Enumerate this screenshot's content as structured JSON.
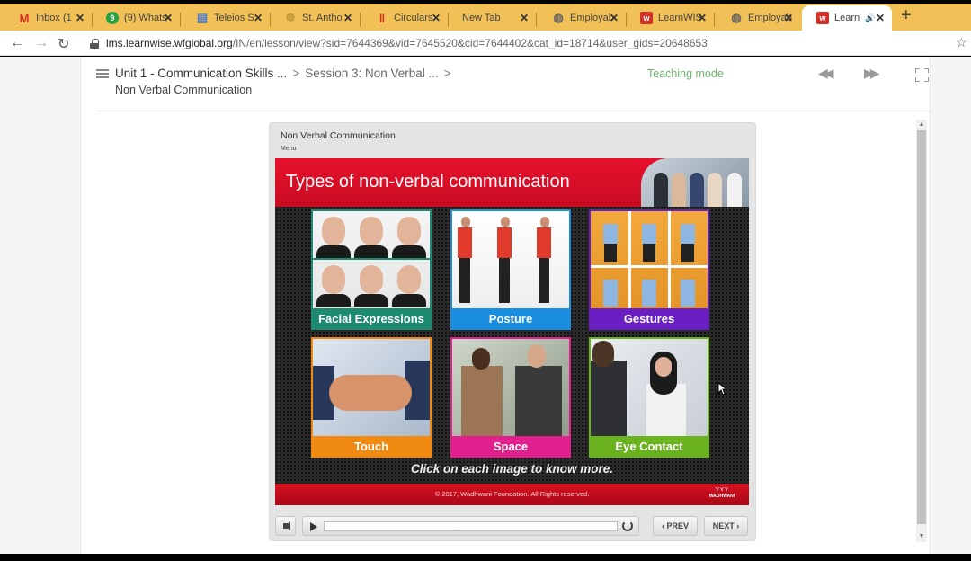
{
  "browser": {
    "tabs": [
      {
        "label": "Inbox (1",
        "icon": "gmail-icon",
        "icon_char": "M",
        "icon_color": "#d93025"
      },
      {
        "label": "(9) Whats",
        "icon": "whatsapp-icon",
        "icon_char": "9",
        "icon_color": "#25a244"
      },
      {
        "label": "Teleios S",
        "icon": "document-icon",
        "icon_char": "▤",
        "icon_color": "#4a7bd0"
      },
      {
        "label": "St. Antho",
        "icon": "school-crest-icon",
        "icon_char": "☸",
        "icon_color": "#c49a3a"
      },
      {
        "label": "Circulars",
        "icon": "circulars-icon",
        "icon_char": "‖",
        "icon_color": "#d62d20"
      },
      {
        "label": "New Tab",
        "icon": "",
        "icon_char": "",
        "icon_color": ""
      },
      {
        "label": "Employab",
        "icon": "globe-icon",
        "icon_char": "◍",
        "icon_color": "#666"
      },
      {
        "label": "LearnWIS",
        "icon": "learnwise-icon",
        "icon_char": "w",
        "icon_color": "#d0322a"
      },
      {
        "label": "Employab",
        "icon": "globe-icon",
        "icon_char": "◍",
        "icon_color": "#666"
      },
      {
        "label": "Learn",
        "icon": "learnwise-icon",
        "icon_char": "w",
        "icon_color": "#d0322a",
        "active": true,
        "audio": "🔊"
      }
    ],
    "close_glyph": "✕",
    "new_tab_glyph": "+",
    "back_glyph": "←",
    "forward_glyph": "→",
    "reload_glyph": "↻",
    "url_domain": "lms.learnwise.wfglobal.org",
    "url_path": "/IN/en/lesson/view?sid=7644369&vid=7645520&cid=7644402&cat_id=18714&user_gids=20648653",
    "bookmark_glyph": "☆"
  },
  "header": {
    "breadcrumb": [
      "Unit 1 - Communication Skills ...",
      "Session 3: Non Verbal ..."
    ],
    "crumb_sep": ">",
    "current_page": "Non Verbal Communication",
    "mode": "Teaching mode",
    "prev_glyph": "◀◀",
    "next_glyph": "▶▶"
  },
  "player": {
    "title": "Non Verbal Communication",
    "menu_label": "Menu",
    "slide": {
      "title": "Types of non-verbal communication",
      "cards": [
        {
          "label": "Facial Expressions",
          "color": "#1e8a72"
        },
        {
          "label": "Posture",
          "color": "#1b8ee0"
        },
        {
          "label": "Gestures",
          "color": "#6a1fc2"
        },
        {
          "label": "Touch",
          "color": "#f08a10"
        },
        {
          "label": "Space",
          "color": "#e0208c"
        },
        {
          "label": "Eye Contact",
          "color": "#6ab21e"
        }
      ],
      "instruction": "Click on each image to know more.",
      "copyright": "© 2017, Wadhwani Foundation. All Rights reserved.",
      "logo_text": "WADHWANI"
    },
    "controls": {
      "prev_label": "‹ PREV",
      "next_label": "NEXT ›",
      "progress": 0
    }
  }
}
